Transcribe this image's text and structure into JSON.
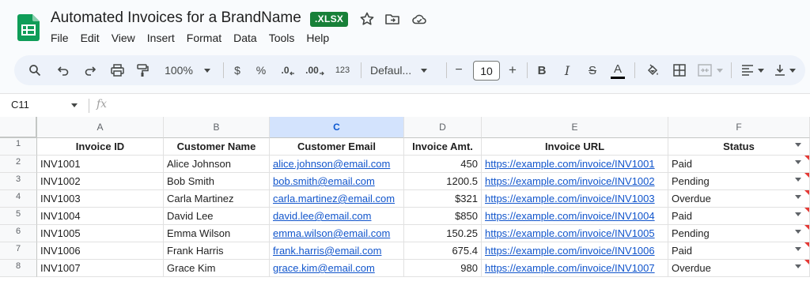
{
  "doc": {
    "title": "Automated Invoices for a BrandName",
    "badge": ".XLSX"
  },
  "menu": [
    "File",
    "Edit",
    "View",
    "Insert",
    "Format",
    "Data",
    "Tools",
    "Help"
  ],
  "toolbar": {
    "zoom": "100%",
    "currency": "$",
    "percent": "%",
    "dec_decrease": ".0",
    "dec_increase": ".00",
    "number_format": "123",
    "font": "Defaul...",
    "font_size": "10",
    "minus": "−",
    "plus": "+",
    "bold": "B",
    "italic": "I",
    "strike": "S",
    "text_color": "A",
    "icons": [
      "search-icon",
      "undo-icon",
      "redo-icon",
      "print-icon",
      "paint-format-icon",
      "fill-color-icon",
      "borders-icon",
      "merge-cells-icon",
      "align-left-icon",
      "vertical-align-icon"
    ]
  },
  "formula": {
    "cell_ref": "C11",
    "fx": "fx",
    "value": ""
  },
  "columns": [
    "A",
    "B",
    "C",
    "D",
    "E",
    "F"
  ],
  "selected_column": "C",
  "rows": [
    "1",
    "2",
    "3",
    "4",
    "5",
    "6",
    "7",
    "8"
  ],
  "headers": [
    "Invoice ID",
    "Customer Name",
    "Customer Email",
    "Invoice Amt.",
    "Invoice URL",
    "Status"
  ],
  "data": [
    [
      "INV1001",
      "Alice Johnson",
      "alice.johnson@email.com",
      "450",
      "https://example.com/invoice/INV1001",
      "Paid"
    ],
    [
      "INV1002",
      "Bob Smith",
      "bob.smith@email.com",
      "1200.5",
      "https://example.com/invoice/INV1002",
      "Pending"
    ],
    [
      "INV1003",
      "Carla Martinez",
      "carla.martinez@email.com",
      "$321",
      "https://example.com/invoice/INV1003",
      "Overdue"
    ],
    [
      "INV1004",
      "David Lee",
      "david.lee@email.com",
      "$850",
      "https://example.com/invoice/INV1004",
      "Paid"
    ],
    [
      "INV1005",
      "Emma Wilson",
      "emma.wilson@email.com",
      "150.25",
      "https://example.com/invoice/INV1005",
      "Pending"
    ],
    [
      "INV1006",
      "Frank Harris",
      "frank.harris@email.com",
      "675.4",
      "https://example.com/invoice/INV1006",
      "Paid"
    ],
    [
      "INV1007",
      "Grace Kim",
      "grace.kim@email.com",
      "980",
      "https://example.com/invoice/INV1007",
      "Overdue"
    ]
  ],
  "colors": {
    "accent": "#0b57d0",
    "link": "#1155cc",
    "badge": "#188038",
    "flag": "#e53935"
  }
}
